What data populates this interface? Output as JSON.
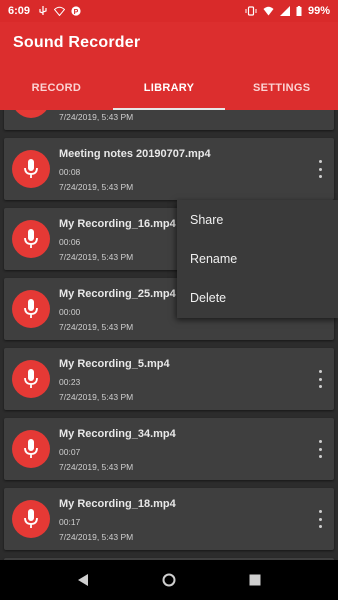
{
  "status_bar": {
    "time": "6:09",
    "battery": "99%"
  },
  "app_bar": {
    "title": "Sound Recorder"
  },
  "tabs": [
    {
      "label": "RECORD",
      "active": false
    },
    {
      "label": "LIBRARY",
      "active": true
    },
    {
      "label": "SETTINGS",
      "active": false
    }
  ],
  "recordings": [
    {
      "name": "",
      "duration": "",
      "date": "7/24/2019, 5:43 PM"
    },
    {
      "name": "Meeting notes 20190707.mp4",
      "duration": "00:08",
      "date": "7/24/2019, 5:43 PM"
    },
    {
      "name": "My Recording_16.mp4",
      "duration": "00:06",
      "date": "7/24/2019, 5:43 PM"
    },
    {
      "name": "My Recording_25.mp4",
      "duration": "00:00",
      "date": "7/24/2019, 5:43 PM"
    },
    {
      "name": "My Recording_5.mp4",
      "duration": "00:23",
      "date": "7/24/2019, 5:43 PM"
    },
    {
      "name": "My Recording_34.mp4",
      "duration": "00:07",
      "date": "7/24/2019, 5:43 PM"
    },
    {
      "name": "My Recording_18.mp4",
      "duration": "00:17",
      "date": "7/24/2019, 5:43 PM"
    }
  ],
  "context_menu": {
    "share": "Share",
    "rename": "Rename",
    "delete": "Delete"
  },
  "colors": {
    "accent": "#dc2e2e",
    "mic": "#e53935",
    "card": "#3f3f3f",
    "background": "#2c2c2c"
  }
}
